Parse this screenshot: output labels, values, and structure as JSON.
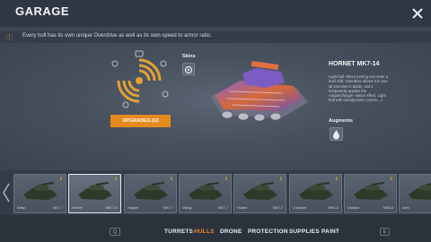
{
  "header": {
    "title": "GARAGE"
  },
  "tip": {
    "text": "Every hull has its own unique Overdrive as well as its own speed to armor ratio."
  },
  "skins": {
    "label": "Skins"
  },
  "upgrade": {
    "label": "UPGRADES (U)"
  },
  "hull": {
    "name": "HORNET MK7-14",
    "description": "Light hull. When turning can enter a brief drift. Overdrive allows it to see all enemies in battle, and it temporarily applies the «Supercharge» status effect. Light hull with aerodynamic curves...",
    "more": "▸"
  },
  "augments": {
    "label": "Augments"
  },
  "carousel": {
    "cards": [
      {
        "name": "Wasp",
        "grade": "MK7-7",
        "locked": false
      },
      {
        "name": "Hornet",
        "grade": "MK7-14",
        "locked": false,
        "selected": true
      },
      {
        "name": "Hopper",
        "grade": "MK7-7",
        "locked": false
      },
      {
        "name": "Viking",
        "grade": "MK7-7",
        "locked": false
      },
      {
        "name": "Hunter",
        "grade": "MK7-7",
        "locked": false
      },
      {
        "name": "Crusader",
        "grade": "MK1-0",
        "locked": false
      },
      {
        "name": "Dictator",
        "grade": "MK6-5",
        "locked": false
      },
      {
        "name": "Ares",
        "grade": "",
        "locked": false
      }
    ]
  },
  "nav": {
    "prev_key": "Q",
    "next_key": "E",
    "tabs": [
      "TURRETS",
      "HULLS",
      "DRONE",
      "PROTECTION",
      "SUPPLIES",
      "PAINT"
    ],
    "active_tab": "HULLS"
  },
  "colors": {
    "accent": "#f08a24",
    "button": "#e68a1e",
    "panel": "#3d4653"
  },
  "icons": {
    "close": "close-icon",
    "info": "info-icon",
    "skins": "skins-icon",
    "augments": "drop-icon"
  }
}
